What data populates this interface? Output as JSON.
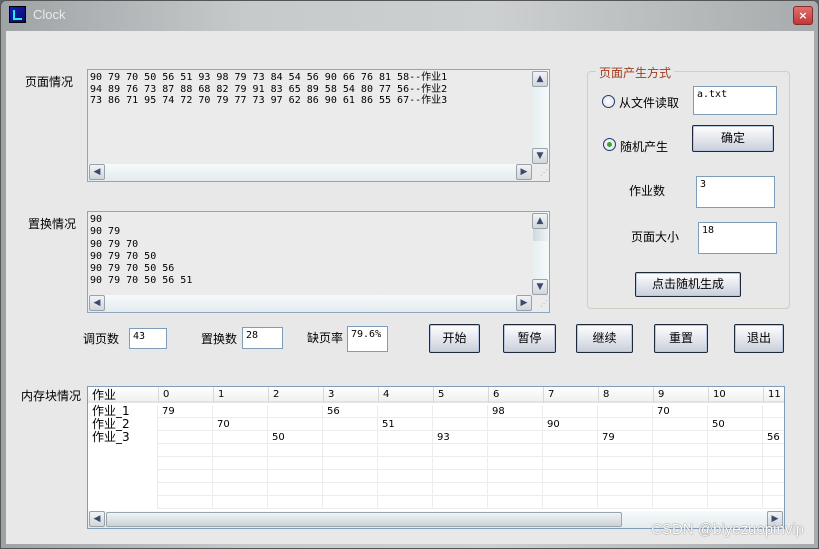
{
  "window": {
    "title": "Clock",
    "close_icon": "×"
  },
  "page_info": {
    "label": "页面情况",
    "lines": [
      "90 79 70 50 56 51 93 98 79 73 84 54 56 90 66 76 81 58--作业1",
      "94 89 76 73 87 88 68 82 79 91 83 65 89 58 54 80 77 56--作业2",
      "73 86 71 95 74 72 70 79 77 73 97 62 86 90 61 86 55 67--作业3"
    ]
  },
  "replace_info": {
    "label": "置换情况",
    "lines": [
      "90",
      "90 79",
      "90 79 70",
      "90 79 70 50",
      "90 79 70 50 56",
      "90 79 70 50 56 51"
    ]
  },
  "stats": {
    "page_calls_label": "调页数",
    "page_calls_value": "43",
    "replacements_label": "置换数",
    "replacements_value": "28",
    "fault_rate_label": "缺页率",
    "fault_rate_value": "79.6%"
  },
  "buttons": {
    "start": "开始",
    "pause": "暂停",
    "resume": "继续",
    "reset": "重置",
    "exit": "退出"
  },
  "generation": {
    "group_label": "页面产生方式",
    "from_file_label": "从文件读取",
    "from_file_selected": false,
    "file_value": "a.txt",
    "random_label": "随机产生",
    "random_selected": true,
    "confirm_label": "确定",
    "job_count_label": "作业数",
    "job_count_value": "3",
    "page_size_label": "页面大小",
    "page_size_value": "18",
    "generate_label": "点击随机生成"
  },
  "memory": {
    "label": "内存块情况",
    "columns": [
      "作业",
      "0",
      "1",
      "2",
      "3",
      "4",
      "5",
      "6",
      "7",
      "8",
      "9",
      "10",
      "11"
    ],
    "rows": [
      [
        "作业_1",
        "79",
        "",
        "",
        "56",
        "",
        "",
        "98",
        "",
        "",
        "70",
        "",
        ""
      ],
      [
        "作业_2",
        "",
        "70",
        "",
        "",
        "51",
        "",
        "",
        "90",
        "",
        "",
        "50",
        ""
      ],
      [
        "作业_3",
        "",
        "",
        "50",
        "",
        "",
        "93",
        "",
        "",
        "79",
        "",
        "",
        "56"
      ],
      [
        "",
        "",
        "",
        "",
        "",
        "",
        "",
        "",
        "",
        "",
        "",
        "",
        ""
      ],
      [
        "",
        "",
        "",
        "",
        "",
        "",
        "",
        "",
        "",
        "",
        "",
        "",
        ""
      ],
      [
        "",
        "",
        "",
        "",
        "",
        "",
        "",
        "",
        "",
        "",
        "",
        "",
        ""
      ],
      [
        "",
        "",
        "",
        "",
        "",
        "",
        "",
        "",
        "",
        "",
        "",
        "",
        ""
      ],
      [
        "",
        "",
        "",
        "",
        "",
        "",
        "",
        "",
        "",
        "",
        "",
        "",
        ""
      ]
    ]
  },
  "watermark": "CSDN @biyezuopinvip"
}
